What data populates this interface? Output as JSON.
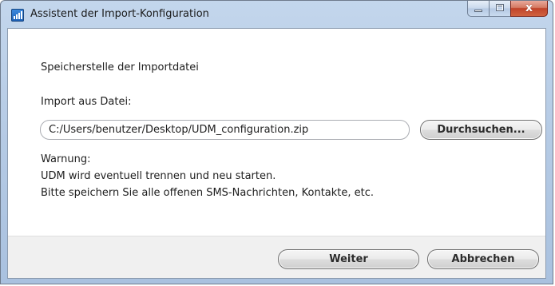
{
  "window": {
    "title": "Assistent der Import-Konfiguration",
    "close_glyph": "x",
    "icon": "app-signal-icon"
  },
  "page": {
    "heading": "Speicherstelle der Importdatei",
    "import_label": "Import aus Datei:",
    "file_path": "C:/Users/benutzer/Desktop/UDM_configuration.zip",
    "browse_label": "Durchsuchen..."
  },
  "warning": {
    "title": "Warnung:",
    "line1": "UDM wird eventuell trennen und neu starten.",
    "line2": "Bitte speichern Sie alle offenen SMS-Nachrichten, Kontakte, etc."
  },
  "footer": {
    "next_label": "Weiter",
    "cancel_label": "Abbrechen"
  },
  "colors": {
    "titlebar": "#b6cbe5",
    "close_button": "#c0432a",
    "footer": "#f0f0f0"
  }
}
